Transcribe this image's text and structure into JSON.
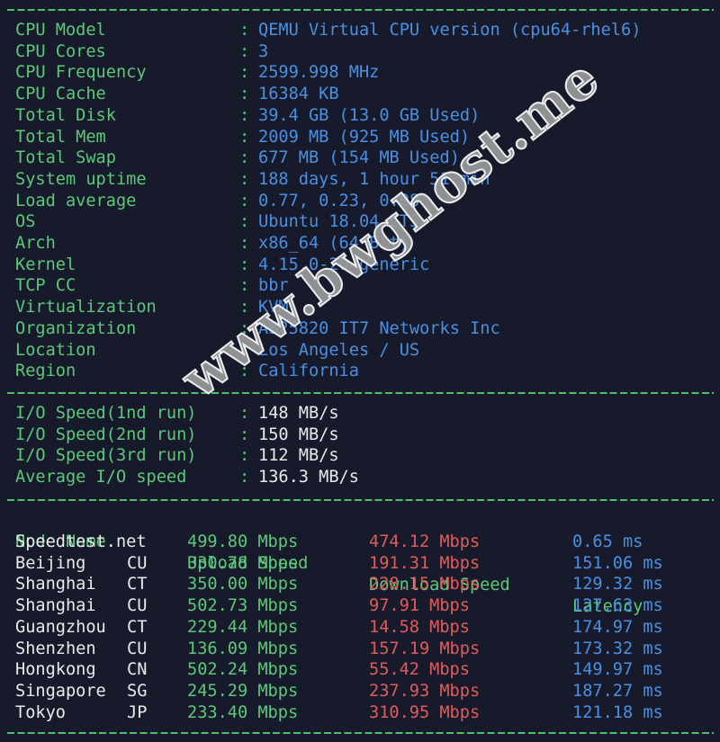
{
  "system_info": [
    {
      "label": "CPU Model",
      "value": "QEMU Virtual CPU version (cpu64-rhel6)"
    },
    {
      "label": "CPU Cores",
      "value": "3"
    },
    {
      "label": "CPU Frequency",
      "value": "2599.998 MHz"
    },
    {
      "label": "CPU Cache",
      "value": "16384 KB"
    },
    {
      "label": "Total Disk",
      "value": "39.4 GB (13.0 GB Used)"
    },
    {
      "label": "Total Mem",
      "value": "2009 MB (925 MB Used)"
    },
    {
      "label": "Total Swap",
      "value": "677 MB (154 MB Used)"
    },
    {
      "label": "System uptime",
      "value": "188 days, 1 hour 51 min"
    },
    {
      "label": "Load average",
      "value": "0.77, 0.23, 0.08"
    },
    {
      "label": "OS",
      "value": "Ubuntu 18.04 LTS"
    },
    {
      "label": "Arch",
      "value": "x86_64 (64 Bit)"
    },
    {
      "label": "Kernel",
      "value": "4.15.0-20-generic"
    },
    {
      "label": "TCP CC",
      "value": "bbr"
    },
    {
      "label": "Virtualization",
      "value": "KVM"
    },
    {
      "label": "Organization",
      "value": "AS25820 IT7 Networks Inc"
    },
    {
      "label": "Location",
      "value": "Los Angeles / US"
    },
    {
      "label": "Region",
      "value": "California"
    }
  ],
  "io_speed": [
    {
      "label": "I/O Speed(1nd run)",
      "value": "148 MB/s"
    },
    {
      "label": "I/O Speed(2nd run)",
      "value": "150 MB/s"
    },
    {
      "label": "I/O Speed(3rd run)",
      "value": "112 MB/s"
    },
    {
      "label": "Average I/O speed",
      "value": "136.3 MB/s"
    }
  ],
  "speed_table": {
    "headers": {
      "node": "Node Name",
      "upload": "Upload Speed",
      "download": "Download Speed",
      "latency": "Latency"
    },
    "rows": [
      {
        "node": "Speedtest.net",
        "isp": "",
        "upload": "499.80 Mbps",
        "download": "474.12 Mbps",
        "latency": "0.65 ms"
      },
      {
        "node": "Beijing",
        "isp": "CU",
        "upload": "330.78 Mbps",
        "download": "191.31 Mbps",
        "latency": "151.06 ms"
      },
      {
        "node": "Shanghai",
        "isp": "CT",
        "upload": "350.00 Mbps",
        "download": "228.15 Mbps",
        "latency": "129.32 ms"
      },
      {
        "node": "Shanghai",
        "isp": "CU",
        "upload": "502.73 Mbps",
        "download": "97.91 Mbps",
        "latency": "127.63 ms"
      },
      {
        "node": "Guangzhou",
        "isp": "CT",
        "upload": "229.44 Mbps",
        "download": "14.58 Mbps",
        "latency": "174.97 ms"
      },
      {
        "node": "Shenzhen",
        "isp": "CU",
        "upload": "136.09 Mbps",
        "download": "157.19 Mbps",
        "latency": "173.32 ms"
      },
      {
        "node": "Hongkong",
        "isp": "CN",
        "upload": "502.24 Mbps",
        "download": "55.42 Mbps",
        "latency": "149.97 ms"
      },
      {
        "node": "Singapore",
        "isp": "SG",
        "upload": "245.29 Mbps",
        "download": "237.93 Mbps",
        "latency": "187.27 ms"
      },
      {
        "node": "Tokyo",
        "isp": "JP",
        "upload": "233.40 Mbps",
        "download": "310.95 Mbps",
        "latency": "121.18 ms"
      }
    ]
  },
  "separator_char": ":",
  "watermark": "www.bwghost.me",
  "colors": {
    "background": "#171a2a",
    "label_green": "#5cc97a",
    "value_blue": "#4a90e2",
    "value_white": "#eaeaea",
    "download_red": "#e05c5c"
  }
}
